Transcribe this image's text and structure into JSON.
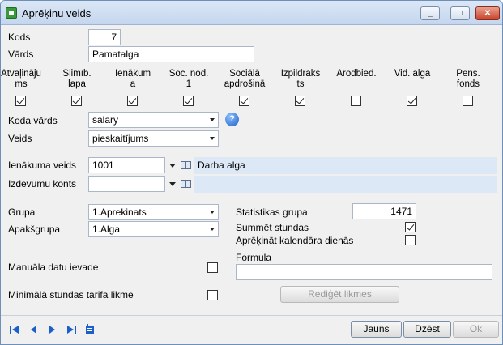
{
  "window": {
    "title": "Aprēķinu veids"
  },
  "fields": {
    "kods": {
      "label": "Kods",
      "value": "7"
    },
    "vards": {
      "label": "Vārds",
      "value": "Pamatalga"
    },
    "koda_vards": {
      "label": "Koda vārds",
      "value": "salary"
    },
    "veids": {
      "label": "Veids",
      "value": "pieskaitījums"
    },
    "ienakuma_veids": {
      "label": "Ienākuma veids",
      "value": "1001",
      "description": "Darba alga"
    },
    "izdevumu_konts": {
      "label": "Izdevumu konts",
      "value": "",
      "description": ""
    },
    "grupa": {
      "label": "Grupa",
      "value": "1.Aprekinats"
    },
    "apaksgrupa": {
      "label": "Apakšgrupa",
      "value": "1.Alga"
    },
    "statistikas_grupa": {
      "label": "Statistikas grupa",
      "value": "1471"
    },
    "summet_stundas": {
      "label": "Summēt stundas",
      "checked": true
    },
    "aprekinat_kal": {
      "label": "Aprēķināt kalendāra dienās",
      "checked": false
    },
    "manuala": {
      "label": "Manuāla datu ievade",
      "checked": false
    },
    "formula": {
      "label": "Formula",
      "value": ""
    },
    "min_stundas": {
      "label": "Minimālā stundas tarifa likme",
      "checked": false
    }
  },
  "columns": [
    {
      "line1": "Atvaļināju",
      "line2": "ms",
      "checked": true
    },
    {
      "line1": "Slimīb.",
      "line2": "lapa",
      "checked": true
    },
    {
      "line1": "Ienākum",
      "line2": "a",
      "checked": true
    },
    {
      "line1": "Soc. nod.",
      "line2": "1",
      "checked": true
    },
    {
      "line1": "Sociālā",
      "line2": "apdrošinā",
      "checked": true
    },
    {
      "line1": "Izpildraks",
      "line2": "ts",
      "checked": true
    },
    {
      "line1": "Arodbied.",
      "line2": "",
      "checked": false
    },
    {
      "line1": "Vid. alga",
      "line2": "",
      "checked": true
    },
    {
      "line1": "Pens.",
      "line2": "fonds",
      "checked": false
    }
  ],
  "buttons": {
    "rediget": "Rediģēt likmes",
    "jauns": "Jauns",
    "dzest": "Dzēst",
    "ok": "Ok"
  },
  "help_label": "?",
  "window_buttons": {
    "min": "_",
    "max": "□",
    "close": "✕"
  }
}
